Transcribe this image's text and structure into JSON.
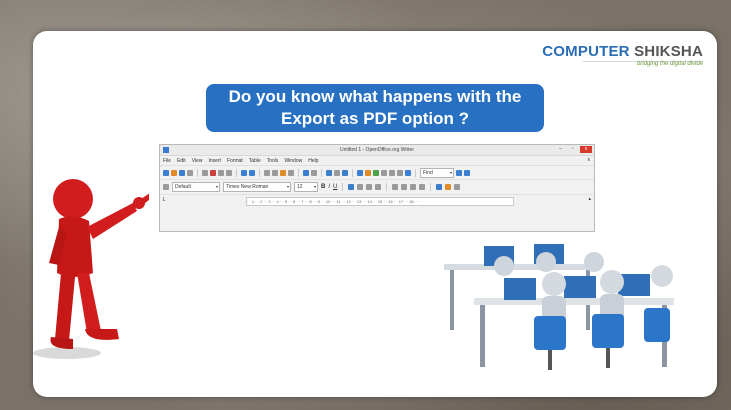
{
  "logo": {
    "part1": "COMPUTER",
    "part2": "SHIKSHA",
    "tagline": "bridging the digital divide"
  },
  "banner": {
    "line1": "Do you know what happens with the",
    "line2": "Export as PDF option ?"
  },
  "writer": {
    "window_title": "Untitled 1 - OpenOffice.org Writer",
    "window_buttons": {
      "minimize": "–",
      "maximize": "▫",
      "close": "x"
    },
    "menu": [
      "File",
      "Edit",
      "View",
      "Insert",
      "Format",
      "Table",
      "Tools",
      "Window",
      "Help"
    ],
    "menu_close": "x",
    "find_placeholder": "Find",
    "paragraph_style": "Default",
    "font_name": "Times New Roman",
    "font_size": "12",
    "bold": "B",
    "italic": "I",
    "underline": "U",
    "ruler_text": "· · 1 · · 2 · · 3 · · 4 · · 5 · · 6 · · 7 · · 8 · · 9 · · 10 · · 11 · · 12 · · 13 · · 14 · · 15 · · 16 · · 17 · · 18 · ·",
    "ruler_left": "L"
  },
  "colors": {
    "banner": "#2770c2",
    "logo_blue": "#2a6db5",
    "figure_red": "#d11d1d",
    "slide_bg": "#ffffff"
  },
  "icons": [
    "pointing-figure-illustration",
    "computer-class-illustration",
    "openoffice-app-icon"
  ]
}
